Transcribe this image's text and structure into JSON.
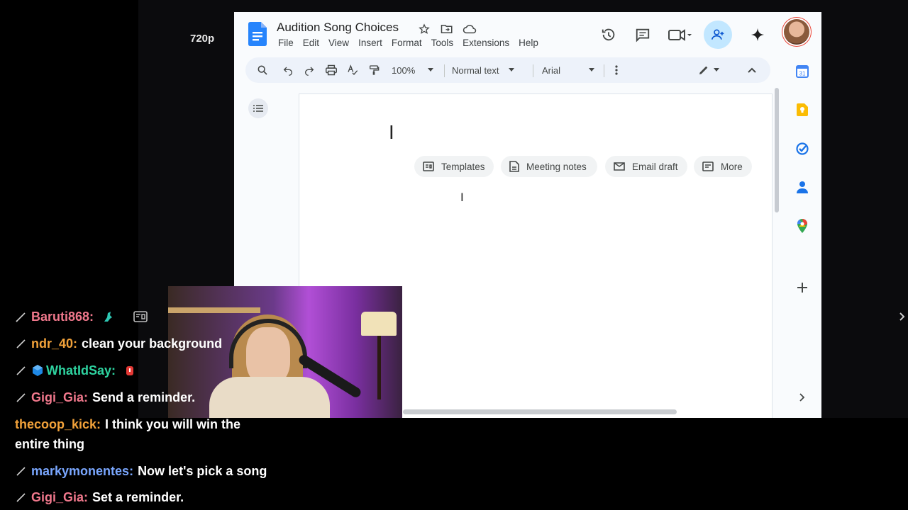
{
  "stream": {
    "quality": "720p"
  },
  "docs": {
    "title": "Audition Song Choices",
    "menu": [
      "File",
      "Edit",
      "View",
      "Insert",
      "Format",
      "Tools",
      "Extensions",
      "Help"
    ],
    "toolbar": {
      "zoom": "100%",
      "style": "Normal text",
      "font": "Arial"
    },
    "chips": [
      "Templates",
      "Meeting notes",
      "Email draft",
      "More"
    ],
    "colors": {
      "accent": "#1a73e8",
      "share_bg": "#c2e7ff",
      "toolbar_bg": "#edf2fa"
    }
  },
  "chat": [
    {
      "user": "Baruti868",
      "user_color": "#f0788c",
      "text": "",
      "emote": "teal-figure-emote",
      "extra_icon": "card-icon"
    },
    {
      "user": "ndr_40",
      "user_color": "#f2a23a",
      "text": "clean your background"
    },
    {
      "user": "WhatIdSay",
      "user_color": "#2ed3a0",
      "text": "",
      "prefix_icon": "cube-icon",
      "emote": "red-lantern-emote"
    },
    {
      "user": "Gigi_Gia",
      "user_color": "#f0788c",
      "text": "Send a reminder."
    },
    {
      "user": "thecoop_kick",
      "user_color": "#f2a23a",
      "text": "I think you will win the",
      "continuation": "entire thing"
    },
    {
      "user": "markymonentes",
      "user_color": "#7aa7ff",
      "text": "Now let's pick a song"
    },
    {
      "user": "Gigi_Gia",
      "user_color": "#f0788c",
      "text": "Set a reminder."
    }
  ]
}
